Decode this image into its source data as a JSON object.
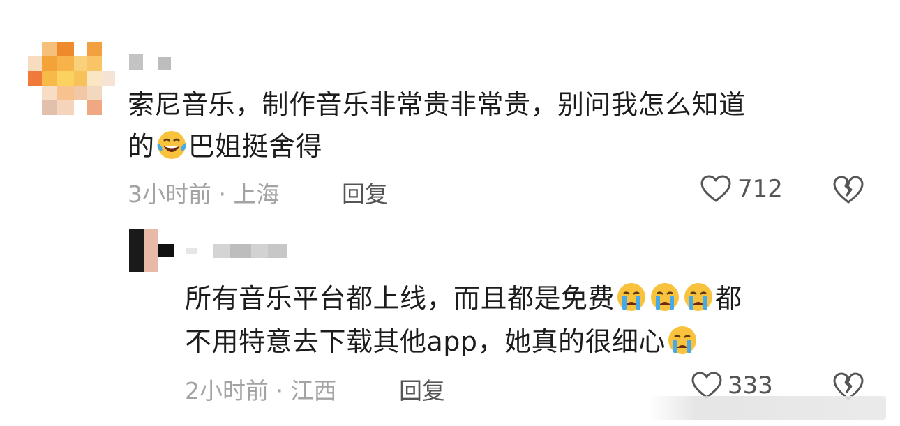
{
  "comments": [
    {
      "text_line1": "索尼音乐，制作音乐非常贵非常贵，别问我怎么知道",
      "text_line2_a": "的",
      "text_line2_b": "巴姐挺舍得",
      "emoji_1": "laughing-crying-emoji",
      "time_location": "3小时前 · 上海",
      "reply_label": "回复",
      "like_count": "712"
    },
    {
      "text_line1": "所有音乐平台都上线，而且都是免费",
      "text_line1_tail": "都",
      "text_line2": "不用特意去下载其他app，她真的很细心",
      "emoji_1": "crying-emoji",
      "time_location": "2小时前 · 江西",
      "reply_label": "回复",
      "like_count": "333"
    }
  ],
  "colors": {
    "text": "#1c1c1c",
    "meta": "#a3a3a3",
    "icon": "#555555"
  }
}
